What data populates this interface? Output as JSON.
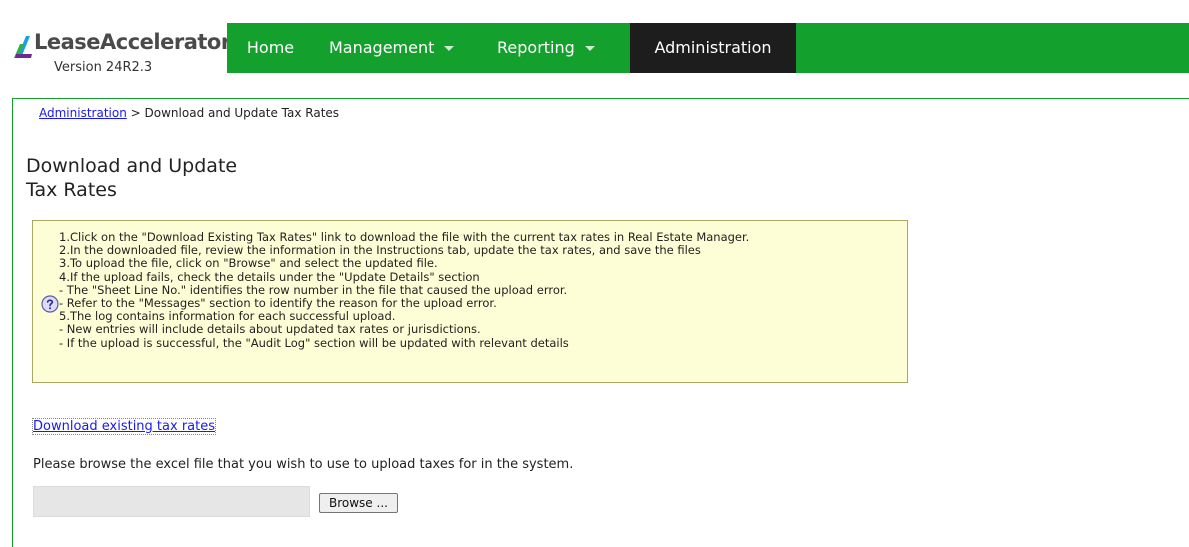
{
  "app": {
    "logo_text": "LeaseAccelerator",
    "version": "Version 24R2.3"
  },
  "nav": {
    "home": "Home",
    "management": "Management",
    "reporting": "Reporting",
    "administration": "Administration"
  },
  "colors": {
    "nav_green": "#14a02c",
    "nav_active": "#1d1d1d",
    "info_bg": "#fefed6",
    "link_blue": "#1a1aee"
  },
  "breadcrumb": {
    "link": "Administration",
    "separator": ">",
    "current": "Download and Update Tax Rates"
  },
  "page": {
    "title_line1": "Download and Update",
    "title_line2": "Tax Rates"
  },
  "instructions": {
    "icon": "question-icon",
    "lines": [
      "1.Click on the \"Download Existing Tax Rates\" link to download the file with the current tax rates in Real Estate Manager.",
      "2.In the downloaded file, review the information in the Instructions tab, update the tax rates, and save the files",
      "3.To upload the file, click on \"Browse\" and select the updated file.",
      "4.If the upload fails, check the details under the \"Update Details\" section",
      "- The \"Sheet Line No.\" identifies the row number in the file that caused the upload error.",
      "- Refer to the \"Messages\" section to identify the reason for the upload error.",
      "5.The log contains information for each successful upload.",
      "- New entries will include details about updated tax rates or jurisdictions.",
      "- If the upload is successful, the \"Audit Log\" section will be updated with relevant details"
    ]
  },
  "download": {
    "link_text": "Download existing tax rates"
  },
  "upload": {
    "prompt": "Please browse the excel file that you wish to use to upload taxes for in the system.",
    "file_value": "",
    "browse_label": "Browse ..."
  }
}
